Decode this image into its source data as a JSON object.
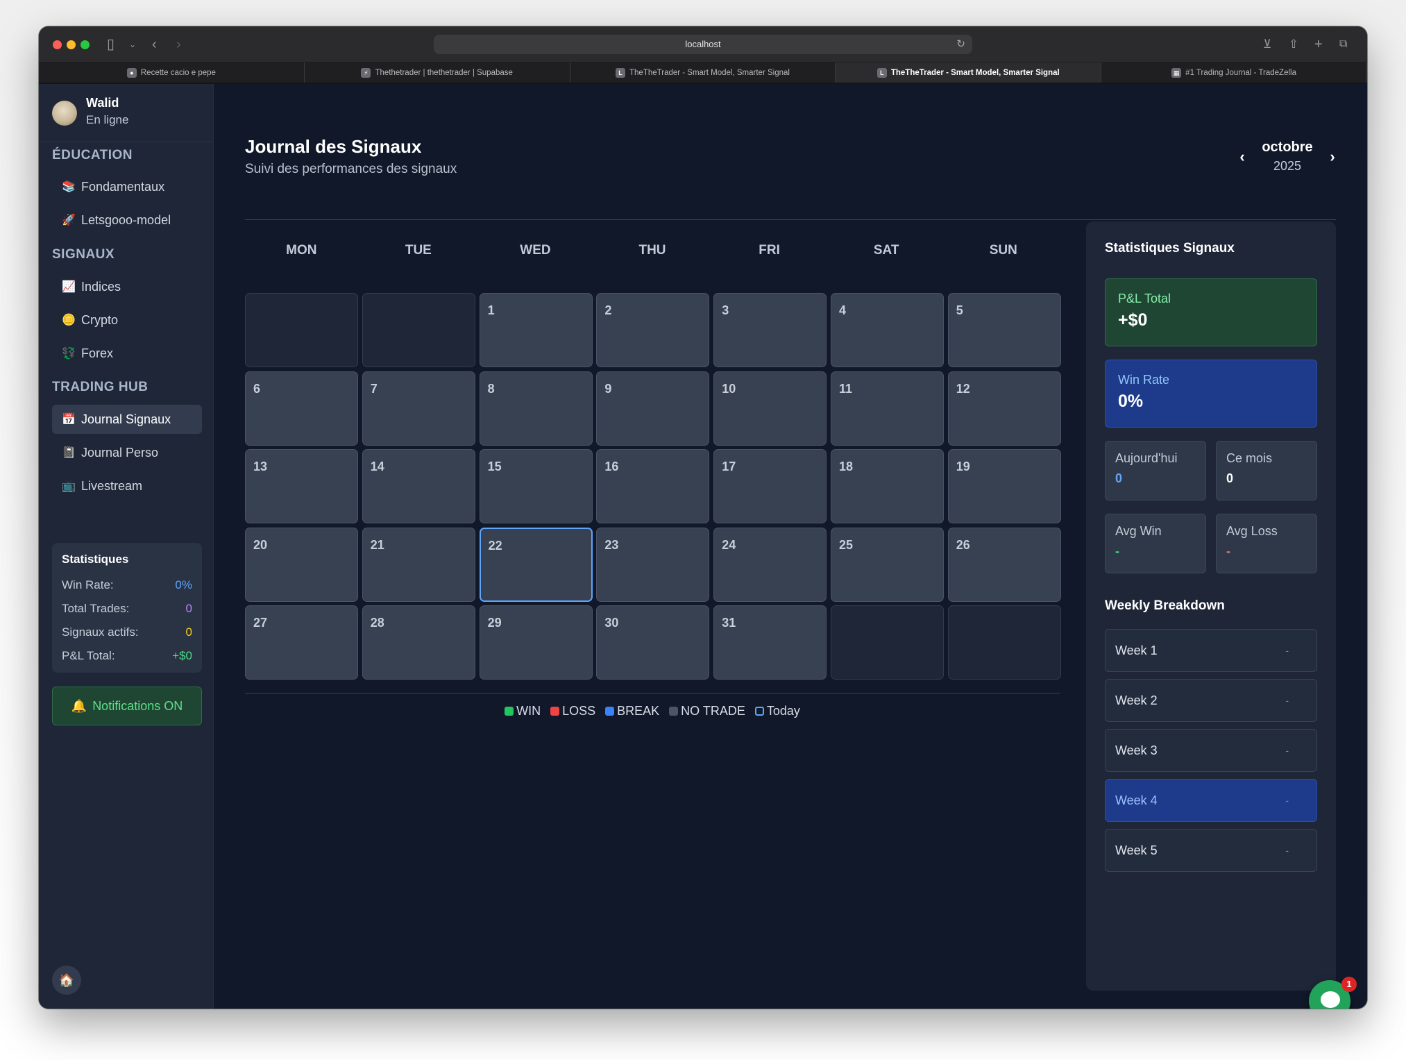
{
  "browser": {
    "url": "localhost",
    "tabs": [
      {
        "label": "Recette cacio e pepe",
        "active": false
      },
      {
        "label": "Thethetrader | thethetrader | Supabase",
        "active": false
      },
      {
        "label": "TheTheTrader - Smart Model, Smarter Signal",
        "active": false
      },
      {
        "label": "TheTheTrader - Smart Model, Smarter Signal",
        "active": true
      },
      {
        "label": "#1 Trading Journal - TradeZella",
        "active": false
      }
    ]
  },
  "user": {
    "name": "Walid",
    "status": "En ligne"
  },
  "sidebar": {
    "sections": [
      {
        "title": "ÉDUCATION",
        "items": [
          {
            "icon": "books-icon",
            "glyph": "📚",
            "label": "Fondamentaux"
          },
          {
            "icon": "rocket-icon",
            "glyph": "🚀",
            "label": "Letsgooo-model"
          }
        ]
      },
      {
        "title": "SIGNAUX",
        "items": [
          {
            "icon": "chart-up-icon",
            "glyph": "📈",
            "label": "Indices"
          },
          {
            "icon": "coin-icon",
            "glyph": "🪙",
            "label": "Crypto"
          },
          {
            "icon": "currency-exchange-icon",
            "glyph": "💱",
            "label": "Forex"
          }
        ]
      },
      {
        "title": "TRADING HUB",
        "items": [
          {
            "icon": "calendar-icon",
            "glyph": "📅",
            "label": "Journal Signaux",
            "active": true
          },
          {
            "icon": "notebook-icon",
            "glyph": "📓",
            "label": "Journal Perso"
          },
          {
            "icon": "tv-icon",
            "glyph": "📺",
            "label": "Livestream"
          }
        ]
      }
    ],
    "stats": {
      "title": "Statistiques",
      "rows": [
        {
          "label": "Win Rate:",
          "value": "0%"
        },
        {
          "label": "Total Trades:",
          "value": "0"
        },
        {
          "label": "Signaux actifs:",
          "value": "0"
        },
        {
          "label": "P&L Total:",
          "value": "+$0"
        }
      ]
    },
    "notifications": {
      "glyph": "🔔",
      "label": "Notifications ON"
    },
    "home": {
      "glyph": "🏠"
    }
  },
  "main": {
    "title": "Journal des Signaux",
    "subtitle": "Suivi des performances des signaux",
    "month": "octobre",
    "year": "2025",
    "prev": "‹",
    "next": "›",
    "weekdays": [
      "MON",
      "TUE",
      "WED",
      "THU",
      "FRI",
      "SAT",
      "SUN"
    ],
    "calendar": {
      "leading_empty": 2,
      "days": 31,
      "trailing_empty": 2,
      "today": 22
    },
    "legend": [
      {
        "label": "WIN",
        "color": "#22c55e"
      },
      {
        "label": "LOSS",
        "color": "#ef4444"
      },
      {
        "label": "BREAK",
        "color": "#3b82f6"
      },
      {
        "label": "NO TRADE",
        "color": "#4b5563"
      },
      {
        "label": "Today",
        "color": "#60a5fa",
        "outline": true
      }
    ]
  },
  "stats_panel": {
    "title": "Statistiques Signaux",
    "pnl": {
      "label": "P&L Total",
      "value": "+$0"
    },
    "winrate": {
      "label": "Win Rate",
      "value": "0%"
    },
    "today": {
      "label": "Aujourd'hui",
      "value": "0"
    },
    "month": {
      "label": "Ce mois",
      "value": "0"
    },
    "avg_win": {
      "label": "Avg Win",
      "value": "-"
    },
    "avg_loss": {
      "label": "Avg Loss",
      "value": "-"
    },
    "weekly_title": "Weekly Breakdown",
    "weeks": [
      {
        "label": "Week 1",
        "value": "-"
      },
      {
        "label": "Week 2",
        "value": "-"
      },
      {
        "label": "Week 3",
        "value": "-"
      },
      {
        "label": "Week 4",
        "value": "-",
        "active": true
      },
      {
        "label": "Week 5",
        "value": "-"
      }
    ]
  },
  "chat": {
    "badge": "1"
  }
}
